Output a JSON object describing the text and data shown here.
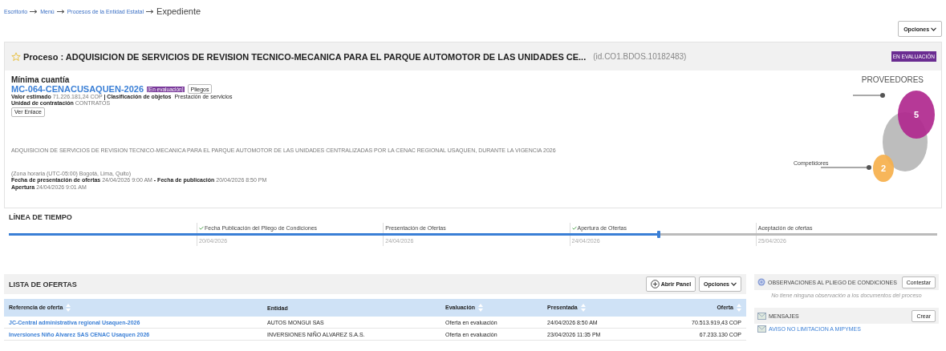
{
  "breadcrumb": {
    "links": [
      "Escritorio",
      "Menú",
      "Procesos de la Entidad Estatal"
    ],
    "current": "Expediente"
  },
  "options_button": "Opciones",
  "process": {
    "title": "Proceso : ADQUISICION DE SERVICIOS DE REVISION TECNICO-MECANICA PARA EL PARQUE AUTOMOTOR DE LAS UNIDADES CE...",
    "id": "(id.CO1.BDOS.10182483)",
    "favorite": false,
    "status": "EN EVALUACIÓN",
    "type": "Mínima cuantía",
    "reference": "MC-064-CENACUSAQUEN-2026",
    "reference_status": "[En evaluación]",
    "pliegos_button": "Pliegos",
    "value_label": "Valor estimado",
    "value": "71.226.181,24 COP",
    "class_label": "| Clasificación de objetos",
    "class_value": "Prestación de servicios",
    "unit_label": "Unidad de contratación",
    "unit_value": "CONTRATOS",
    "link_button": "Ver Enlace",
    "description": "ADQUISICION DE SERVICIOS DE REVISION TECNICO-MECANICA PARA EL PARQUE AUTOMOTOR DE LAS UNIDADES CENTRALIZADAS POR LA CENAC REGIONAL USAQUEN, DURANTE LA VIGENCIA 2026",
    "timezone": "(Zona horaria (UTC-05:00) Bogotá, Lima, Quito)",
    "offers_date_label": "Fecha de presentación de ofertas",
    "offers_date": "24/04/2026 9:00 AM",
    "pub_date_label": "- Fecha de publicación",
    "pub_date": "20/04/2026 8:50 PM",
    "opening_label": "Apertura",
    "opening_date": "24/04/2026 9:01 AM"
  },
  "providers": {
    "title": "PROVEEDORES",
    "legend": "Competidores",
    "bubbles": [
      {
        "label": "5",
        "color": "#b0288e"
      },
      {
        "label": "2",
        "color": "#f6b04c"
      }
    ]
  },
  "timeline": {
    "title": "LÍNEA DE TIEMPO",
    "level": 0.7,
    "steps": [
      {
        "label": "Fecha Publicación del Pliego de Condiciones",
        "date": "20/04/2026",
        "done": true
      },
      {
        "label": "Presentación de Ofertas",
        "date": "24/04/2026",
        "done": false
      },
      {
        "label": "Apertura de Ofertas",
        "date": "24/04/2026",
        "done": true
      },
      {
        "label": "Aceptación de ofertas",
        "date": "25/04/2026",
        "done": false
      }
    ]
  },
  "offers": {
    "title": "LISTA DE OFERTAS",
    "open_panel_button": "Abrir Panel",
    "options_button": "Opciones",
    "columns": [
      {
        "label": "Referencia de oferta",
        "sortable": true
      },
      {
        "label": "Entidad",
        "sortable": false
      },
      {
        "label": "Evaluación",
        "sortable": true
      },
      {
        "label": "Presentada",
        "sortable": true
      },
      {
        "label": "Oferta",
        "sortable": true
      }
    ],
    "rows": [
      [
        "JC-Central administrativa regional Usaquen-2026",
        "AUTOS MONGUI SAS",
        "Oferta en evaluación",
        "24/04/2026 8:50 AM",
        "70.513.919,43 COP"
      ],
      [
        "Inversiones Niño Alvarez SAS CENAC Usaquen 2026",
        "INVERSIONES NIÑO ALVAREZ S.A.S.",
        "Oferta en evaluación",
        "23/04/2026 11:35 PM",
        "67.233.130 COP"
      ]
    ]
  },
  "observations": {
    "title": "OBSERVACIONES AL PLIEGO DE CONDICIONES",
    "button": "Contestar",
    "empty": "No tiene ninguna observación a los documentos del proceso"
  },
  "messages": {
    "title": "MENSAJES",
    "button": "Crear",
    "items": [
      "AVISO NO LIMITACION A MIPYMES"
    ]
  }
}
